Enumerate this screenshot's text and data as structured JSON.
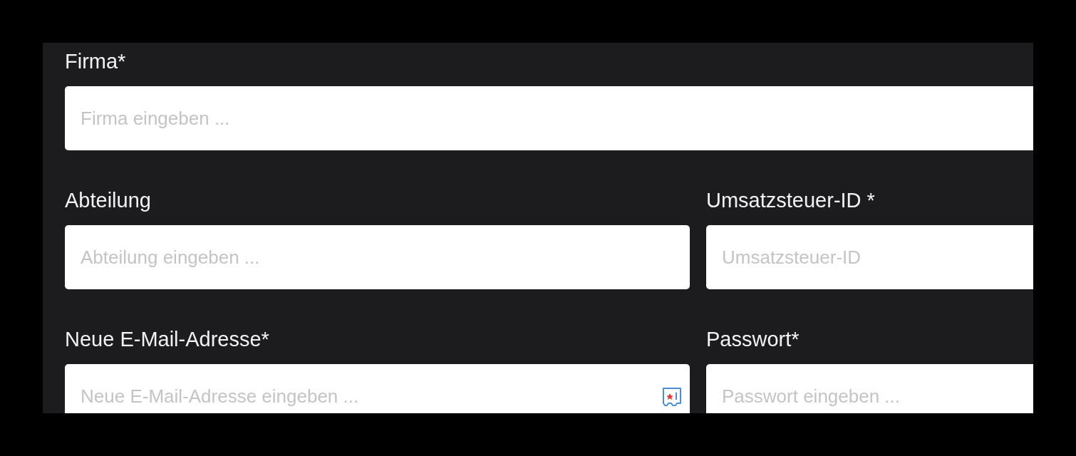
{
  "rows": [
    {
      "fields": [
        {
          "label": "Firma*",
          "placeholder": "Firma eingeben ..."
        }
      ]
    },
    {
      "fields": [
        {
          "label": "Abteilung",
          "placeholder": "Abteilung eingeben ..."
        },
        {
          "label": "Umsatzsteuer-ID *",
          "placeholder": "Umsatzsteuer-ID"
        }
      ]
    },
    {
      "fields": [
        {
          "label": "Neue E-Mail-Adresse*",
          "placeholder": "Neue E-Mail-Adresse eingeben ...",
          "autofill_icon": true
        },
        {
          "label": "Passwort*",
          "placeholder": "Passwort eingeben ..."
        }
      ]
    }
  ]
}
